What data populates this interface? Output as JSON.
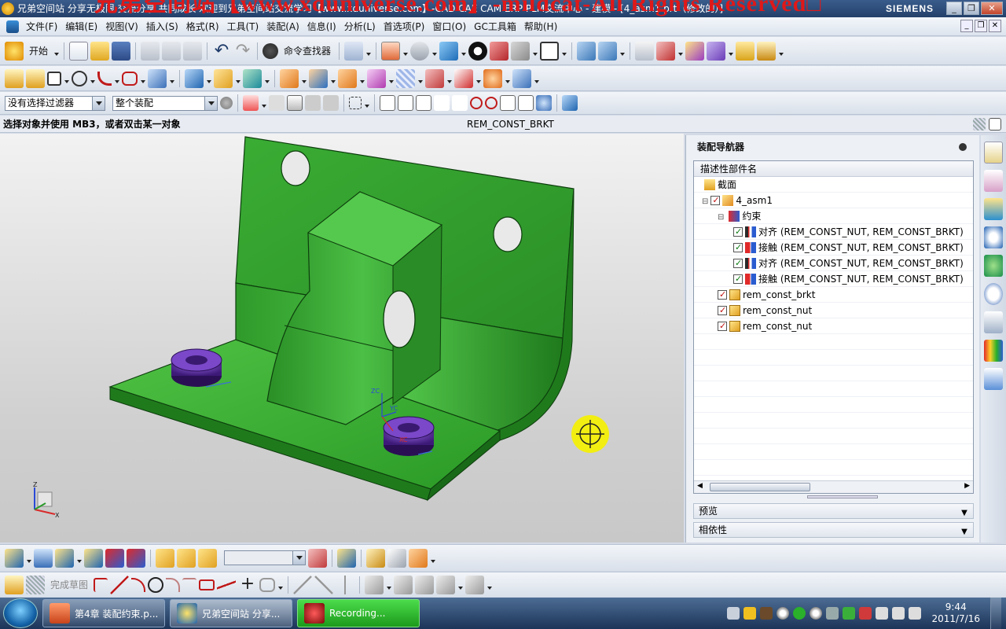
{
  "window": {
    "title": "兄弟空间站 分享无极限 交流分享 共同成长 欢迎到兄弟空间站交流学习【www.xduniverse.com】-CAD CAE CAM ERP PLM交流中心 - 建模 - [4_asm1.prt（修改的）]",
    "watermark": "兄弟空间站【www.xduniverse.com】-mildcat-All Rights Reserved□",
    "brand": "SIEMENS"
  },
  "menu": {
    "items": [
      "文件(F)",
      "编辑(E)",
      "视图(V)",
      "插入(S)",
      "格式(R)",
      "工具(T)",
      "装配(A)",
      "信息(I)",
      "分析(L)",
      "首选项(P)",
      "窗口(O)",
      "GC工具箱",
      "帮助(H)"
    ]
  },
  "toolbar1": {
    "start_label": "开始",
    "command_finder_label": "命令查找器"
  },
  "selection": {
    "filter_value": "没有选择过滤器",
    "scope_value": "整个装配"
  },
  "status": {
    "prompt": "选择对象并使用 MB3，或者双击某一对象",
    "selected_part": "REM_CONST_BRKT"
  },
  "navigator": {
    "title": "装配导航器",
    "column_header": "描述性部件名",
    "rows": [
      {
        "indent": 0,
        "label": "截面",
        "icon": "folder-icon",
        "check": "none"
      },
      {
        "indent": 0,
        "label": "4_asm1",
        "icon": "assembly-icon",
        "check": "red"
      },
      {
        "indent": 1,
        "label": "约束",
        "icon": "constraints-icon",
        "check": "none"
      },
      {
        "indent": 2,
        "label": "对齐 (REM_CONST_NUT, REM_CONST_BRKT)",
        "icon": "align-constraint-icon",
        "check": "green"
      },
      {
        "indent": 2,
        "label": "接触 (REM_CONST_NUT, REM_CONST_BRKT)",
        "icon": "touch-constraint-icon",
        "check": "green"
      },
      {
        "indent": 2,
        "label": "对齐 (REM_CONST_NUT, REM_CONST_BRKT)",
        "icon": "align-constraint-icon",
        "check": "green"
      },
      {
        "indent": 2,
        "label": "接触 (REM_CONST_NUT, REM_CONST_BRKT)",
        "icon": "touch-constraint-icon",
        "check": "green"
      },
      {
        "indent": 1,
        "label": "rem_const_brkt",
        "icon": "part-icon",
        "check": "red"
      },
      {
        "indent": 1,
        "label": "rem_const_nut",
        "icon": "part-icon",
        "check": "red"
      },
      {
        "indent": 1,
        "label": "rem_const_nut",
        "icon": "part-icon",
        "check": "red"
      }
    ],
    "preview_label": "预览",
    "dependencies_label": "相依性"
  },
  "viewport": {
    "triad_labels": {
      "x": "X",
      "y": "Y",
      "z": "Z"
    },
    "csys_labels": {
      "z": "ZC",
      "y": "YC",
      "x": "XC"
    }
  },
  "sketch_toolbar": {
    "finish_sketch_label": "完成草图"
  },
  "taskbar": {
    "items": [
      {
        "label": "第4章 装配约束.p...",
        "icon": "powerpoint-icon"
      },
      {
        "label": "兄弟空间站 分享...",
        "icon": "nx-icon"
      },
      {
        "label": "Recording...",
        "icon": "recorder-icon"
      }
    ],
    "time": "9:44",
    "date": "2011/7/16"
  },
  "colors": {
    "part_green": "#2fa02a",
    "nut_purple": "#5a2a9c",
    "accent_blue": "#24406a"
  }
}
